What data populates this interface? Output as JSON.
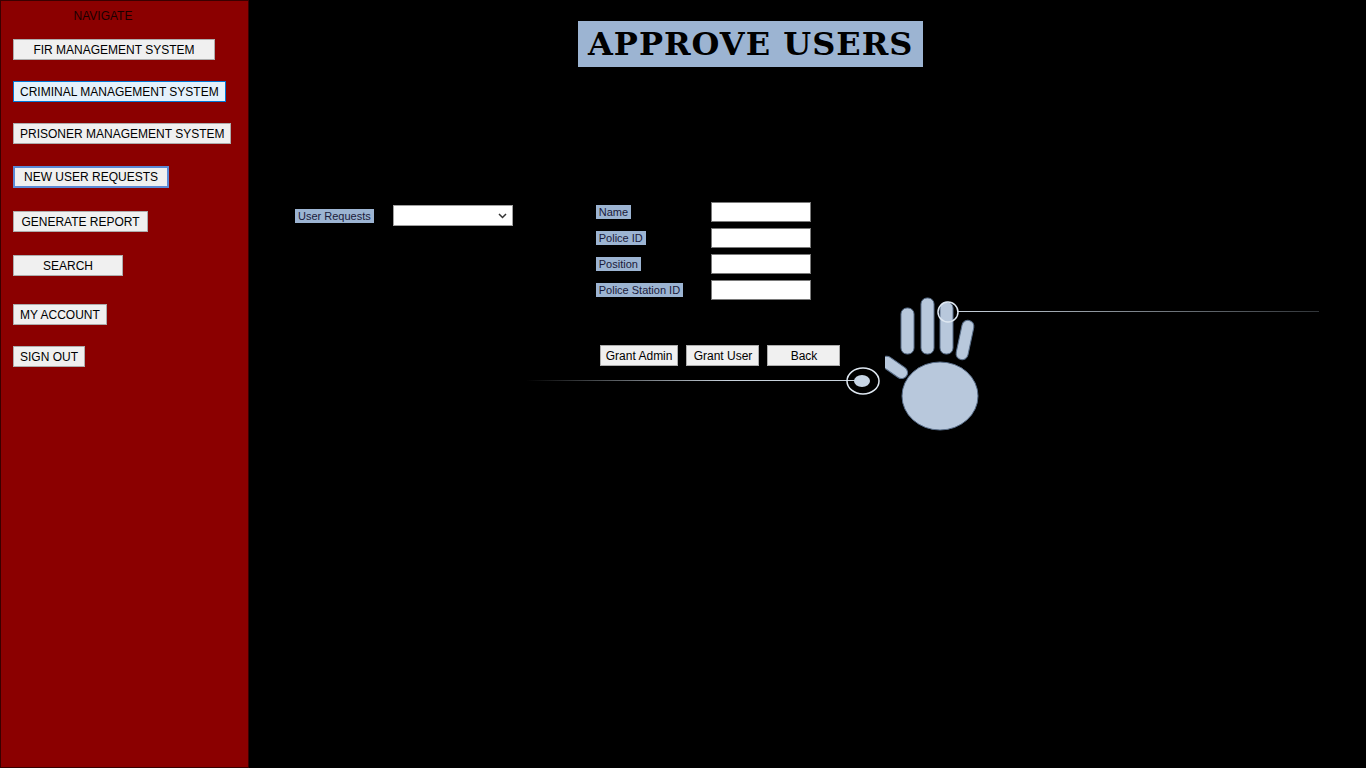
{
  "sidebar": {
    "heading": "NAVIGATE",
    "items": [
      {
        "label": "FIR MANAGEMENT SYSTEM",
        "hovered": false,
        "focused": false
      },
      {
        "label": "CRIMINAL MANAGEMENT SYSTEM",
        "hovered": true,
        "focused": false
      },
      {
        "label": "PRISONER MANAGEMENT SYSTEM",
        "hovered": false,
        "focused": false
      },
      {
        "label": "NEW USER REQUESTS",
        "hovered": false,
        "focused": true
      },
      {
        "label": "GENERATE REPORT",
        "hovered": false,
        "focused": false
      },
      {
        "label": "SEARCH",
        "hovered": false,
        "focused": false
      },
      {
        "label": "MY ACCOUNT",
        "hovered": false,
        "focused": false
      },
      {
        "label": "SIGN OUT",
        "hovered": false,
        "focused": false
      }
    ]
  },
  "title": "APPROVE USERS",
  "user_requests": {
    "label": "User Requests",
    "value": ""
  },
  "fields": [
    {
      "label": "Name",
      "value": ""
    },
    {
      "label": "Police ID",
      "value": ""
    },
    {
      "label": "Position",
      "value": ""
    },
    {
      "label": "Police Station ID",
      "value": ""
    }
  ],
  "buttons": [
    "Grant Admin",
    "Grant User",
    "Back"
  ]
}
